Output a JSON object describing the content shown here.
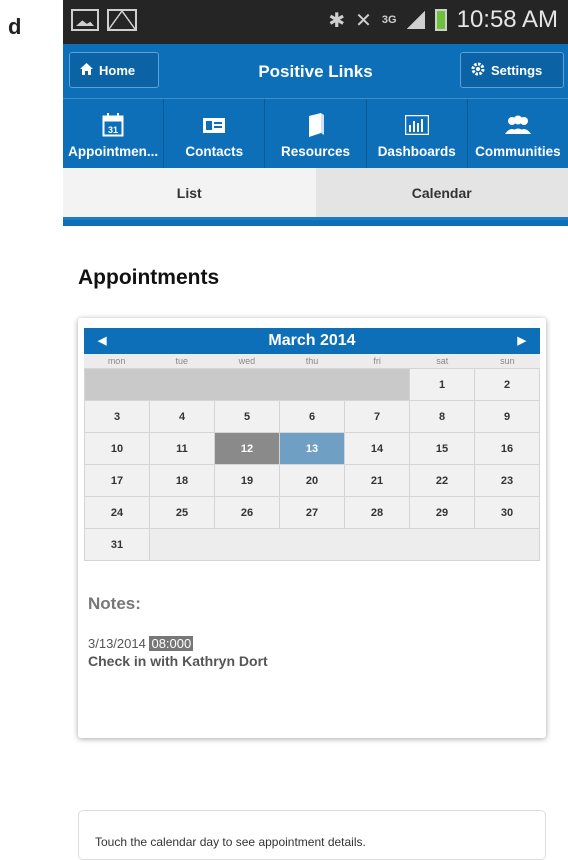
{
  "panel_letter": "d",
  "status_bar": {
    "time": "10:58 AM",
    "network": "3G",
    "icons": [
      "image-icon",
      "mail-icon",
      "bluetooth-icon",
      "mute-icon",
      "signal-icon",
      "battery-icon"
    ]
  },
  "header": {
    "home_label": "Home",
    "title": "Positive Links",
    "settings_label": "Settings"
  },
  "nav": {
    "items": [
      {
        "label": "Appointmen...",
        "icon": "calendar-icon",
        "icon_text": "31"
      },
      {
        "label": "Contacts",
        "icon": "contact-card-icon"
      },
      {
        "label": "Resources",
        "icon": "book-icon"
      },
      {
        "label": "Dashboards",
        "icon": "bar-chart-icon"
      },
      {
        "label": "Communities",
        "icon": "people-icon"
      }
    ]
  },
  "tabs": {
    "list_label": "List",
    "calendar_label": "Calendar"
  },
  "page_title": "Appointments",
  "calendar": {
    "month_label": "March 2014",
    "prev_arrow": "◀",
    "next_arrow": "▶",
    "weekdays": [
      "mon",
      "tue",
      "wed",
      "thu",
      "fri",
      "sat",
      "sun"
    ],
    "days": [
      "1",
      "2",
      "3",
      "4",
      "5",
      "6",
      "7",
      "8",
      "9",
      "10",
      "11",
      "12",
      "13",
      "14",
      "15",
      "16",
      "17",
      "18",
      "19",
      "20",
      "21",
      "22",
      "23",
      "24",
      "25",
      "26",
      "27",
      "28",
      "29",
      "30",
      "31"
    ],
    "selected_days": [
      "12",
      "13"
    ]
  },
  "notes": {
    "title": "Notes:",
    "date": "3/13/2014",
    "time": "08:000",
    "text": "Check in with Kathryn Dort"
  },
  "hint": "Touch the calendar day to see appointment details.",
  "colors": {
    "accent": "#0d6fb8",
    "status_bar": "#252525",
    "selected_day_12": "#8a8a8a",
    "selected_day_13": "#6f9fc2"
  }
}
